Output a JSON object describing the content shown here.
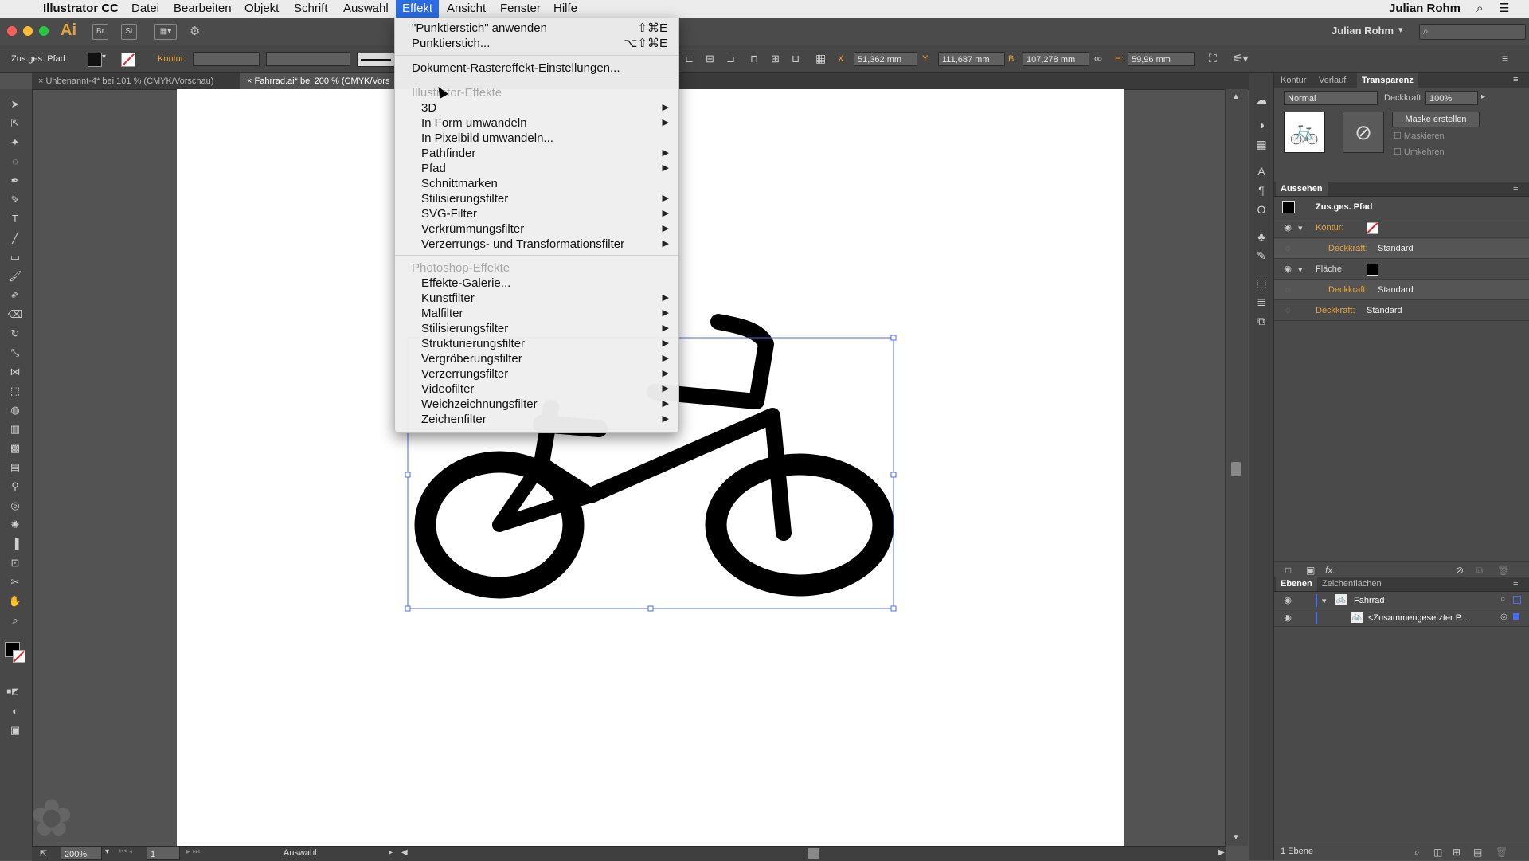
{
  "menubar": {
    "app_name": "Illustrator CC",
    "items": [
      "Datei",
      "Bearbeiten",
      "Objekt",
      "Schrift",
      "Auswahl",
      "Effekt",
      "Ansicht",
      "Fenster",
      "Hilfe"
    ],
    "active_item": "Effekt",
    "user": "Julian Rohm"
  },
  "appbar": {
    "logo": "Ai",
    "bridge": "Br",
    "stock": "St",
    "user": "Julian Rohm",
    "user_menu_arrow": "▾",
    "search_placeholder": ""
  },
  "controlbar": {
    "selection_label": "Zus.ges. Pfad",
    "stroke_label": "Kontur:",
    "x_label": "X:",
    "x_value": "51,362 mm",
    "y_label": "Y:",
    "y_value": "111,687 mm",
    "w_label": "B:",
    "w_value": "107,278 mm",
    "h_label": "H:",
    "h_value": "59,96 mm"
  },
  "tabs": [
    {
      "label": "Unbenannt-4* bei 101 % (CMYK/Vorschau)",
      "active": false
    },
    {
      "label": "Fahrrad.ai* bei 200 % (CMYK/Vors",
      "active": true
    }
  ],
  "effekt_menu": {
    "apply_last": "\"Punktierstich\" anwenden",
    "apply_last_shortcut": "⇧⌘E",
    "last_effect": "Punktierstich...",
    "last_effect_shortcut": "⌥⇧⌘E",
    "raster_settings": "Dokument-Rastereffekt-Einstellungen...",
    "illustrator_header": "Illustrator-Effekte",
    "illustrator_items": [
      {
        "label": "3D",
        "submenu": true
      },
      {
        "label": "In Form umwandeln",
        "submenu": true
      },
      {
        "label": "In Pixelbild umwandeln...",
        "submenu": false
      },
      {
        "label": "Pathfinder",
        "submenu": true
      },
      {
        "label": "Pfad",
        "submenu": true
      },
      {
        "label": "Schnittmarken",
        "submenu": false
      },
      {
        "label": "Stilisierungsfilter",
        "submenu": true
      },
      {
        "label": "SVG-Filter",
        "submenu": true
      },
      {
        "label": "Verkrümmungsfilter",
        "submenu": true
      },
      {
        "label": "Verzerrungs- und Transformationsfilter",
        "submenu": true
      }
    ],
    "photoshop_header": "Photoshop-Effekte",
    "photoshop_items": [
      {
        "label": "Effekte-Galerie...",
        "submenu": false
      },
      {
        "label": "Kunstfilter",
        "submenu": true
      },
      {
        "label": "Malfilter",
        "submenu": true
      },
      {
        "label": "Stilisierungsfilter",
        "submenu": true
      },
      {
        "label": "Strukturierungsfilter",
        "submenu": true
      },
      {
        "label": "Vergröberungsfilter",
        "submenu": true
      },
      {
        "label": "Verzerrungsfilter",
        "submenu": true
      },
      {
        "label": "Videofilter",
        "submenu": true
      },
      {
        "label": "Weichzeichnungsfilter",
        "submenu": true
      },
      {
        "label": "Zeichenfilter",
        "submenu": true
      }
    ]
  },
  "transparency_panel": {
    "tabs": [
      "Kontur",
      "Verlauf",
      "Transparenz"
    ],
    "active_tab": "Transparenz",
    "blend_mode": "Normal",
    "opacity_label": "Deckkraft:",
    "opacity_value": "100%",
    "make_mask": "Maske erstellen",
    "clip": "Maskieren",
    "invert": "Umkehren"
  },
  "appearance_panel": {
    "title": "Aussehen",
    "object": "Zus.ges. Pfad",
    "stroke_label": "Kontur:",
    "stroke_opacity_label": "Deckkraft:",
    "stroke_opacity_value": "Standard",
    "fill_label": "Fläche:",
    "fill_opacity_label": "Deckkraft:",
    "fill_opacity_value": "Standard",
    "opacity_label": "Deckkraft:",
    "opacity_value": "Standard",
    "fx_label": "fx."
  },
  "layers_panel": {
    "tabs": [
      "Ebenen",
      "Zeichenflächen"
    ],
    "active_tab": "Ebenen",
    "layers": [
      {
        "name": "Fahrrad",
        "expanded": true
      },
      {
        "name": "<Zusammengesetzter P...",
        "expanded": false
      }
    ],
    "footer": "1 Ebene"
  },
  "statusbar": {
    "zoom": "200%",
    "artboard": "1",
    "tool": "Auswahl"
  },
  "colors": {
    "accent": "#2b6ce6",
    "artboard": "#ffffff",
    "selection": "#4a6cf7"
  }
}
